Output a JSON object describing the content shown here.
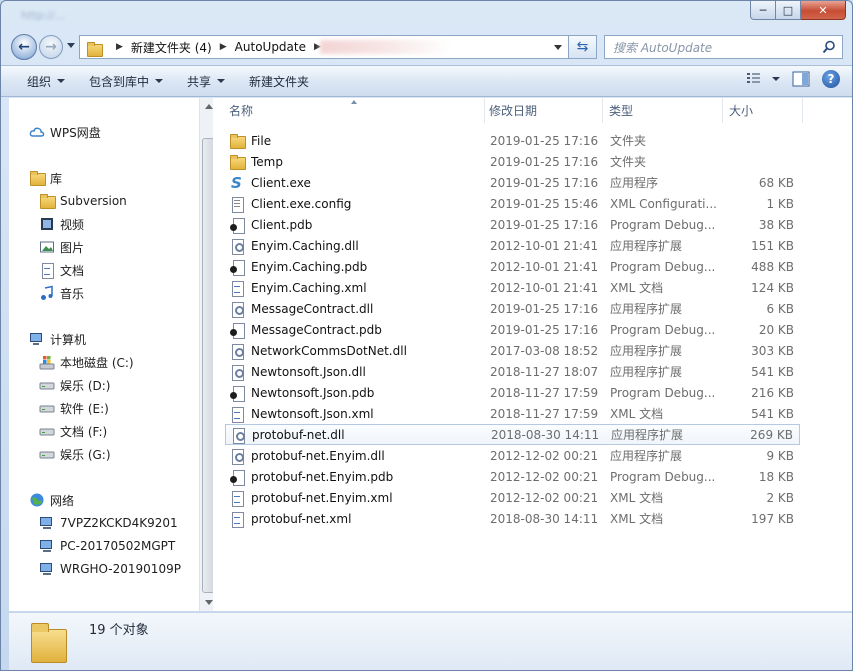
{
  "window": {
    "title_blurred": "http://...",
    "controls": {
      "minimize": "─",
      "maximize": "□",
      "close": "✕"
    }
  },
  "address": {
    "crumbs": [
      "新建文件夹 (4)",
      "AutoUpdate"
    ],
    "search_placeholder": "搜索 AutoUpdate"
  },
  "toolbar": {
    "organize": "组织",
    "include_library": "包含到库中",
    "share": "共享",
    "new_folder": "新建文件夹",
    "help": "?"
  },
  "nav": {
    "wps": "WPS网盘",
    "library": "库",
    "library_items": [
      "Subversion",
      "视频",
      "图片",
      "文档",
      "音乐"
    ],
    "computer": "计算机",
    "drives": [
      "本地磁盘 (C:)",
      "娱乐 (D:)",
      "软件 (E:)",
      "文档 (F:)",
      "娱乐 (G:)"
    ],
    "network": "网络",
    "network_items": [
      "7VPZ2KCKD4K9201",
      "PC-20170502MGPT",
      "WRGHO-20190109P"
    ]
  },
  "columns": {
    "name": "名称",
    "date": "修改日期",
    "type": "类型",
    "size": "大小"
  },
  "files": [
    {
      "name": "File",
      "date": "2019-01-25 17:16",
      "type": "文件夹",
      "size": "",
      "icon": "folder-icon"
    },
    {
      "name": "Temp",
      "date": "2019-01-25 17:16",
      "type": "文件夹",
      "size": "",
      "icon": "folder-icon"
    },
    {
      "name": "Client.exe",
      "date": "2019-01-25 17:16",
      "type": "应用程序",
      "size": "68 KB",
      "icon": "exe-icon"
    },
    {
      "name": "Client.exe.config",
      "date": "2019-01-25 15:46",
      "type": "XML Configurati...",
      "size": "1 KB",
      "icon": "config-icon"
    },
    {
      "name": "Client.pdb",
      "date": "2019-01-25 17:16",
      "type": "Program Debug...",
      "size": "38 KB",
      "icon": "pdb-icon"
    },
    {
      "name": "Enyim.Caching.dll",
      "date": "2012-10-01 21:41",
      "type": "应用程序扩展",
      "size": "151 KB",
      "icon": "dll-icon"
    },
    {
      "name": "Enyim.Caching.pdb",
      "date": "2012-10-01 21:41",
      "type": "Program Debug...",
      "size": "488 KB",
      "icon": "pdb-icon"
    },
    {
      "name": "Enyim.Caching.xml",
      "date": "2012-10-01 21:41",
      "type": "XML 文档",
      "size": "124 KB",
      "icon": "xml-icon"
    },
    {
      "name": "MessageContract.dll",
      "date": "2019-01-25 17:16",
      "type": "应用程序扩展",
      "size": "6 KB",
      "icon": "dll-icon"
    },
    {
      "name": "MessageContract.pdb",
      "date": "2019-01-25 17:16",
      "type": "Program Debug...",
      "size": "20 KB",
      "icon": "pdb-icon"
    },
    {
      "name": "NetworkCommsDotNet.dll",
      "date": "2017-03-08 18:52",
      "type": "应用程序扩展",
      "size": "303 KB",
      "icon": "dll-icon"
    },
    {
      "name": "Newtonsoft.Json.dll",
      "date": "2018-11-27 18:07",
      "type": "应用程序扩展",
      "size": "541 KB",
      "icon": "dll-icon"
    },
    {
      "name": "Newtonsoft.Json.pdb",
      "date": "2018-11-27 17:59",
      "type": "Program Debug...",
      "size": "216 KB",
      "icon": "pdb-icon"
    },
    {
      "name": "Newtonsoft.Json.xml",
      "date": "2018-11-27 17:59",
      "type": "XML 文档",
      "size": "541 KB",
      "icon": "xml-icon"
    },
    {
      "name": "protobuf-net.dll",
      "date": "2018-08-30 14:11",
      "type": "应用程序扩展",
      "size": "269 KB",
      "icon": "dll-icon",
      "selected": true
    },
    {
      "name": "protobuf-net.Enyim.dll",
      "date": "2012-12-02 00:21",
      "type": "应用程序扩展",
      "size": "9 KB",
      "icon": "dll-icon"
    },
    {
      "name": "protobuf-net.Enyim.pdb",
      "date": "2012-12-02 00:21",
      "type": "Program Debug...",
      "size": "18 KB",
      "icon": "pdb-icon"
    },
    {
      "name": "protobuf-net.Enyim.xml",
      "date": "2012-12-02 00:21",
      "type": "XML 文档",
      "size": "2 KB",
      "icon": "xml-icon"
    },
    {
      "name": "protobuf-net.xml",
      "date": "2018-08-30 14:11",
      "type": "XML 文档",
      "size": "197 KB",
      "icon": "xml-icon"
    }
  ],
  "status": {
    "count": "19 个对象"
  }
}
